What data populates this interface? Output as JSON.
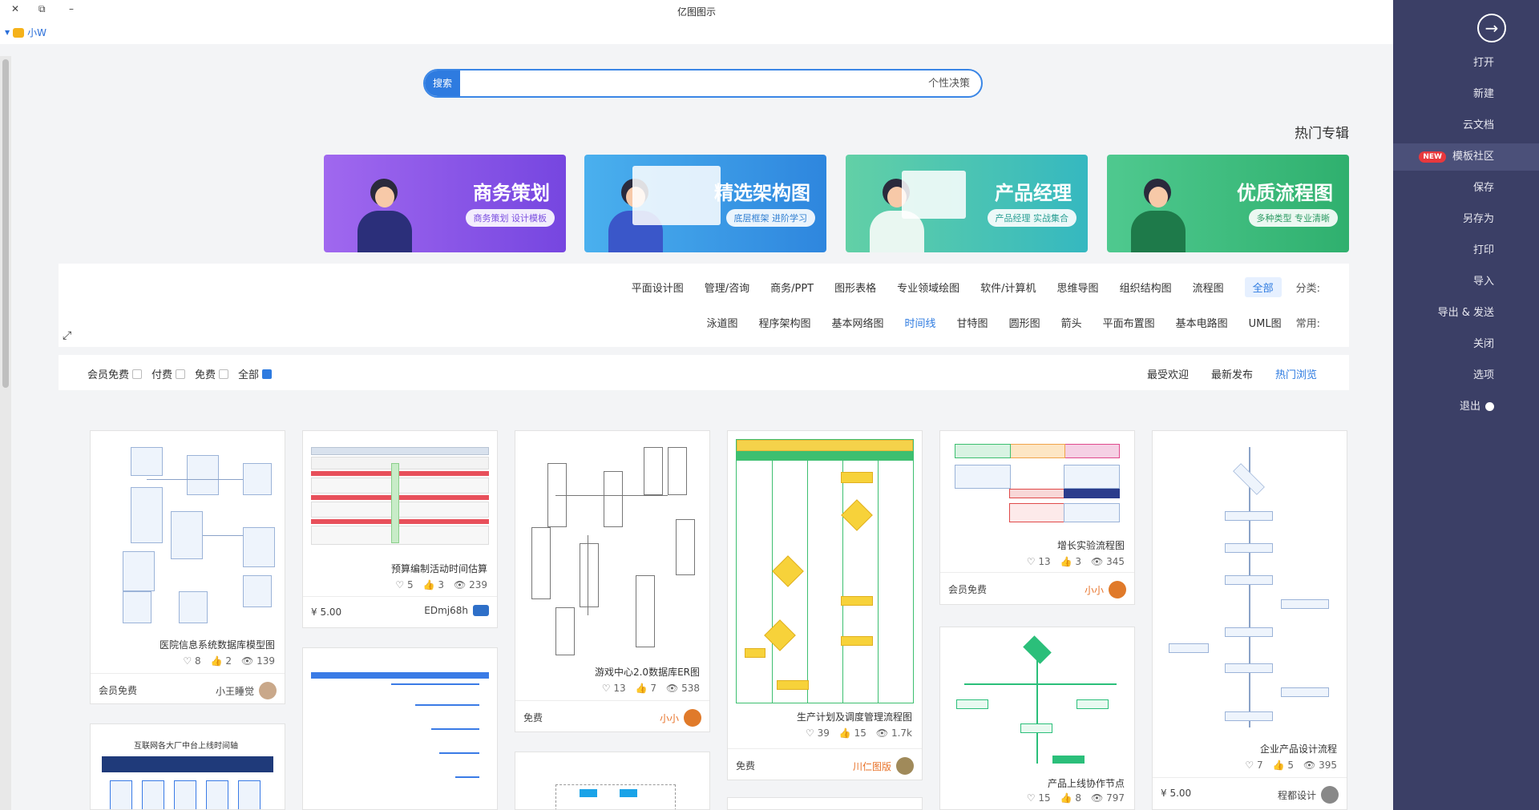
{
  "window": {
    "title": "亿图图示",
    "close": "✕",
    "minimize": "–",
    "restore": "⧉",
    "user": "小W"
  },
  "sidebar": {
    "back_icon": "arrow-right-circle-icon",
    "items": [
      {
        "label": "打开"
      },
      {
        "label": "新建"
      },
      {
        "label": "云文档"
      },
      {
        "label": "模板社区",
        "badge": "NEW"
      },
      {
        "label": "保存"
      },
      {
        "label": "另存为"
      },
      {
        "label": "打印"
      },
      {
        "label": "导入"
      },
      {
        "label": "导出 & 发送"
      },
      {
        "label": "关闭"
      },
      {
        "label": "选项"
      },
      {
        "label": "退出"
      }
    ]
  },
  "search": {
    "button": "搜索",
    "placeholder": "个性决策"
  },
  "hot": {
    "title": "热门专辑",
    "banners": [
      {
        "title": "优质流程图",
        "sub": "多种类型 专业清晰",
        "color": "#3ec08a"
      },
      {
        "title": "产品经理",
        "sub": "产品经理 实战集合",
        "color": "#3cc6ad"
      },
      {
        "title": "精选架构图",
        "sub": "底层框架 进阶学习",
        "color": "#3a9fe8"
      },
      {
        "title": "商务策划",
        "sub": "商务策划 设计模板",
        "color": "#8a58e6"
      }
    ]
  },
  "categories": {
    "label1": "分类:",
    "row1": [
      "全部",
      "流程图",
      "组织结构图",
      "思维导图",
      "软件/计算机",
      "专业领域绘图",
      "图形表格",
      "商务/PPT",
      "管理/咨询",
      "平面设计图"
    ],
    "label2": "常用:",
    "row2": [
      "UML图",
      "基本电路图",
      "平面布置图",
      "箭头",
      "圆形图",
      "甘特图",
      "时间线",
      "基本网络图",
      "程序架构图",
      "泳道图"
    ]
  },
  "filter": {
    "sort": [
      "热门浏览",
      "最新发布",
      "最受欢迎"
    ],
    "checks": [
      "全部",
      "免费",
      "付费",
      "会员免费"
    ]
  },
  "cards": [
    {
      "title": "企业产品设计流程",
      "views": "395",
      "likes": "5",
      "favs": "7",
      "author": "程都设计",
      "price": "¥ 5.00"
    },
    {
      "title": "增长实验流程图",
      "views": "345",
      "likes": "3",
      "favs": "13",
      "author": "小小",
      "price": "会员免费"
    },
    {
      "title": "生产计划及调度管理流程图",
      "views": "1.7k",
      "likes": "15",
      "favs": "39",
      "author": "川仁图版",
      "price": "免费"
    },
    {
      "title": "游戏中心2.0数据库ER图",
      "views": "538",
      "likes": "7",
      "favs": "13",
      "author": "小小",
      "price": "免费"
    },
    {
      "title": "预算编制活动时间估算",
      "views": "239",
      "likes": "3",
      "favs": "5",
      "author": "EDmj68h",
      "price": "¥ 5.00"
    },
    {
      "title": "医院信息系统数据库模型图",
      "views": "139",
      "likes": "2",
      "favs": "8",
      "author": "小王睡觉",
      "price": "会员免费"
    },
    {
      "title": "产品上线协作节点",
      "views": "797",
      "likes": "8",
      "favs": "15"
    },
    {
      "title": "互联网各大厂中台上线时间轴"
    }
  ]
}
